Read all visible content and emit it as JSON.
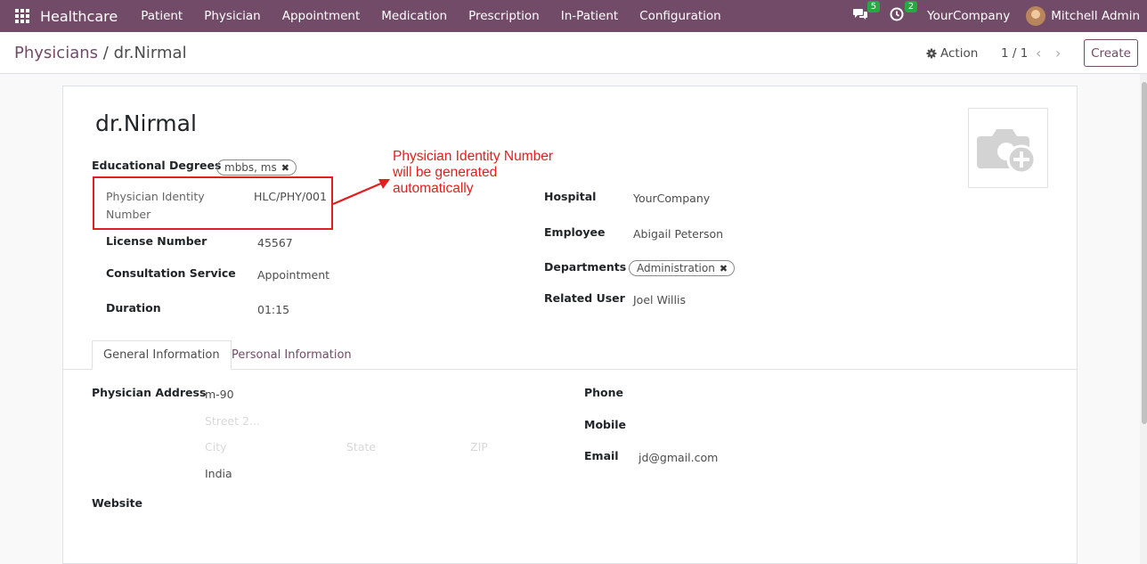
{
  "navbar": {
    "brand": "Healthcare",
    "menu": [
      "Patient",
      "Physician",
      "Appointment",
      "Medication",
      "Prescription",
      "In-Patient",
      "Configuration"
    ],
    "messages_count": "5",
    "activities_count": "2",
    "company": "YourCompany",
    "user": "Mitchell Admin"
  },
  "control": {
    "breadcrumb_parent": "Physicians",
    "breadcrumb_sep": "/",
    "breadcrumb_current": "dr.Nirmal",
    "action_label": "Action",
    "pager": "1 / 1",
    "create_label": "Create"
  },
  "form": {
    "name": "dr.Nirmal",
    "educational_degrees_label": "Educational Degrees",
    "educational_degrees_tag": "mbbs, ms",
    "identity_label_1": "Physician Identity",
    "identity_label_2": "Number",
    "identity_value": "HLC/PHY/001",
    "license_label": "License Number",
    "license_value": "45567",
    "consultation_label": "Consultation Service",
    "consultation_value": "Appointment",
    "duration_label": "Duration",
    "duration_value": "01:15",
    "hospital_label": "Hospital",
    "hospital_value": "YourCompany",
    "employee_label": "Employee",
    "employee_value": "Abigail Peterson",
    "departments_label": "Departments",
    "departments_tag": "Administration",
    "related_user_label": "Related User",
    "related_user_value": "Joel Willis"
  },
  "annotation": {
    "line1": "Physician Identity Number",
    "line2": "will be generated",
    "line3": "automatically"
  },
  "tabs": {
    "general": "General Information",
    "personal": "Personal Information"
  },
  "general_info": {
    "address_label": "Physician Address",
    "street": "m-90",
    "street2_placeholder": "Street 2...",
    "city_placeholder": "City",
    "state_placeholder": "State",
    "zip_placeholder": "ZIP",
    "country": "India",
    "website_label": "Website",
    "phone_label": "Phone",
    "mobile_label": "Mobile",
    "email_label": "Email",
    "email_value": "jd@gmail.com"
  },
  "colors": {
    "brand": "#714b67",
    "annotation": "#e02020",
    "badge": "#28a745"
  }
}
